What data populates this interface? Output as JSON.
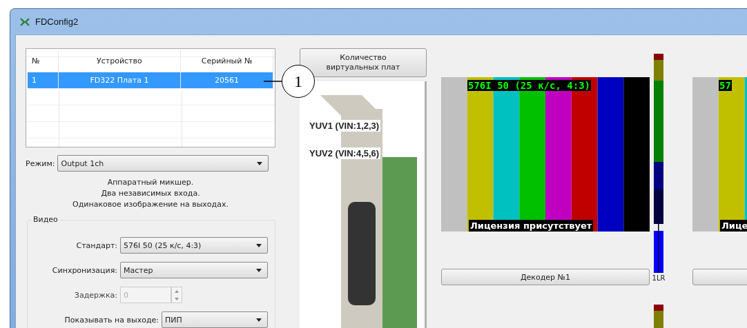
{
  "window": {
    "title": "FDConfig2"
  },
  "device_table": {
    "columns": [
      "№",
      "Устройство",
      "Серийный №"
    ],
    "rows": [
      {
        "cells": [
          "1",
          "FD322 Плата 1",
          "20561"
        ],
        "selected": true
      }
    ]
  },
  "mode": {
    "label": "Режим:",
    "value": "Output 1ch"
  },
  "mode_description": [
    "Аппаратный микшер.",
    "Два независимых входа.",
    "Одинаковое изображение на выходах."
  ],
  "video_group": {
    "title": "Видео",
    "fields": [
      {
        "kind": "select",
        "label": "Стандарт:",
        "value": "576I 50 (25 к/с, 4:3)"
      },
      {
        "kind": "select",
        "label": "Синхронизация:",
        "value": "Мастер"
      },
      {
        "kind": "spin",
        "label": "Задержка:",
        "value": "0",
        "disabled": true
      },
      {
        "kind": "select",
        "label": "Показывать на выходе:",
        "value": "ПИП"
      }
    ]
  },
  "card_count_button": "Количество виртуальных плат",
  "card_labels": [
    "YUV1 (VIN:1,2,3)",
    "YUV2 (VIN:4,5,6)"
  ],
  "decoders": [
    {
      "format_text": "576I 50 (25 к/с, 4:3)",
      "license_text": "Лицензия присутствует",
      "button_label": "Декодер №1",
      "meter_label": "1LR"
    },
    {
      "format_text": "57",
      "license_text": "Лице"
    }
  ],
  "callout": {
    "number": "1"
  }
}
